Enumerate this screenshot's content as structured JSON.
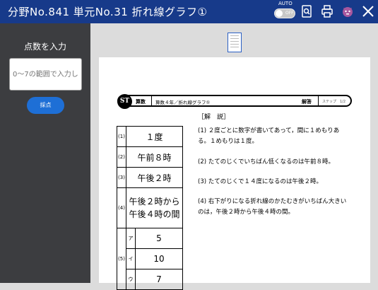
{
  "header": {
    "title": "分野No.841 単元No.31 折れ線グラフ①",
    "auto_label": "AUTO",
    "toggle_state": "OFF",
    "icons": [
      "search-document-icon",
      "print-icon",
      "character-icon",
      "close-icon"
    ],
    "bg_color": "#173a8a"
  },
  "left_panel": {
    "prompt": "点数を入力",
    "input_placeholder": "0〜7の範囲で入力し",
    "grade_button": "採点"
  },
  "sheet": {
    "logo": "ST",
    "subject": "算数",
    "title": "算数４年／折れ線グラフ①",
    "answer_label": "解答",
    "step": "ステップ　1/2",
    "kaisetsu": "［解　説］"
  },
  "answers": {
    "q1": {
      "num": "(1)",
      "value": "１度"
    },
    "q2": {
      "num": "(2)",
      "value": "午前８時"
    },
    "q3": {
      "num": "(3)",
      "value": "午後２時"
    },
    "q4": {
      "num": "(4)",
      "line1": "午後２時から",
      "line2": "午後４時の間"
    },
    "q5": {
      "num": "(5)",
      "a_label": "ア",
      "a": "5",
      "i_label": "イ",
      "i": "10",
      "u_label": "ウ",
      "u": "7"
    }
  },
  "explanations": {
    "e1": "(1) ２度ごとに数字が書いてあって，間に１めもりある。１めもりは１度。",
    "e2": "(2) たてのじくでいちばん低くなるのは午前８時。",
    "e3": "(3) たてのじくで１４度になるのは午後２時。",
    "e4": "(4) 右下がりになる折れ線のかたむきがいちばん大きいのは，午後２時から午後４時の間。"
  }
}
